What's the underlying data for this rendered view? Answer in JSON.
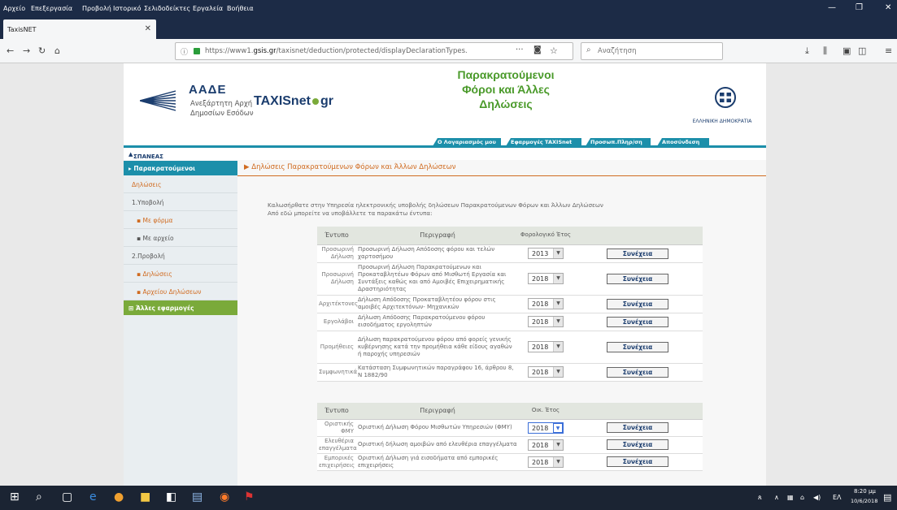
{
  "browser": {
    "menu": [
      "Αρχείο",
      "Επεξεργασία",
      "Προβολή",
      "Ιστορικό",
      "Σελιδοδείκτες",
      "Εργαλεία",
      "Βοήθεια"
    ],
    "tab_title": "TaxisNET",
    "url_prefix": "https://www1.",
    "url_domain": "gsis.gr",
    "url_rest": "/taxisnet/deduction/protected/displayDeclarationTypes.",
    "search_placeholder": "Αναζήτηση"
  },
  "header": {
    "aade_logo": "ΑΑΔΕ",
    "aade_line1": "Ανεξάρτητη Αρχή",
    "aade_line2": "Δημοσίων Εσόδων",
    "taxis_logo_a": "TAXISnet",
    "taxis_logo_b": "gr",
    "site_title_1": "Παρακρατούμενοι",
    "site_title_2": "Φόροι και Άλλες",
    "site_title_3": "Δηλώσεις",
    "hd_label": "ΕΛΛΗΝΙΚΗ ΔΗΜΟΚΡΑΤΙΑ"
  },
  "topnav": [
    "Ο Λογαριασμός μου",
    "Εφαρμογές TAXISnet",
    "Προσωπ.Πληρ/ση",
    "Αποσύνδεση"
  ],
  "user": "ΣΠΑΝΕΑΣ ΛΕΩ. ΔΗΜΗΤΡΙΟΣ",
  "sidebar": {
    "section": "Παρακρατούμενοι",
    "items": [
      "Δηλώσεις",
      "1.Υποβολή",
      "Με φόρμα",
      "Με αρχείο",
      "2.Προβολή",
      "Δηλώσεις",
      "Αρχείου Δηλώσεων"
    ],
    "other": "Άλλες εφαρμογές"
  },
  "content": {
    "title": "Δηλώσεις Παρακρατούμενων Φόρων και Άλλων Δηλώσεων",
    "intro_1": "Καλωσήρθατε στην Υπηρεσία ηλεκτρονικής υποβολής δηλώσεων Παρακρατούμενων Φόρων και Άλλων Δηλώσεων",
    "intro_2": "Από εδώ μπορείτε να υποβάλλετε τα παρακάτω έντυπα:",
    "table1_headers": [
      "Έντυπο",
      "Περιγραφή",
      "Φορολογικό Έτος"
    ],
    "table2_headers": [
      "Έντυπο",
      "Περιγραφή",
      "Οικ. Έτος"
    ],
    "button_label": "Συνέχεια",
    "table1_rows": [
      {
        "form": "Προσωρινή Δήλωση",
        "desc": "Προσωρινή Δήλωση Απόδοσης φόρου και τελών χαρτοσήμου",
        "year": "2013"
      },
      {
        "form": "Προσωρινή Δήλωση",
        "desc": "Προσωρινή Δήλωση Παρακρατούμενων και Προκαταβλητέων Φόρων από Μισθωτή Εργασία και Συντάξεις καθώς και από Αμοιβές Επιχειρηματικής Δραστηριότητας",
        "year": "2018"
      },
      {
        "form": "Αρχιτέκτονες",
        "desc": "Δήλωση Απόδοσης Προκαταβλητέου φόρου στις αμοιβές Αρχιτεκτόνων- Μηχανικών",
        "year": "2018"
      },
      {
        "form": "Εργολάβοι",
        "desc": "Δήλωση Απόδοσης Παρακρατούμενου φόρου εισοδήματος εργοληπτών",
        "year": "2018"
      },
      {
        "form": "Προμήθειες",
        "desc": "Δήλωση παρακρατούμενου φόρου από φορείς γενικής κυβέρνησης κατά την προμήθεια κάθε είδους αγαθών ή παροχής υπηρεσιών",
        "year": "2018"
      },
      {
        "form": "Συμφωνητικά",
        "desc": "Κατάσταση Συμφωνητικών παραγράφου 16, άρθρου 8, Ν 1882/90",
        "year": "2018"
      }
    ],
    "table2_rows": [
      {
        "form": "Οριστικής ΦΜΥ",
        "desc": "Οριστική Δήλωση Φόρου Μισθωτών Υπηρεσιών (ΦΜΥ)",
        "year": "2018"
      },
      {
        "form": "Ελευθέρια επαγγέλματα",
        "desc": "Οριστική δήλωση αμοιβών από ελευθέρια επαγγέλματα",
        "year": "2018"
      },
      {
        "form": "Εμπορικές επιχειρήσεις",
        "desc": "Οριστική Δήλωση γιά εισοδήματα από εμπορικές επιχειρήσεις",
        "year": "2018"
      }
    ]
  },
  "taskbar": {
    "lang": "ΕΛ",
    "time": "8:20 μμ",
    "date": "10/6/2018"
  },
  "icons": [
    "back-icon",
    "forward-icon",
    "reload-icon",
    "home-icon",
    "lock-icon",
    "bookmark-star-icon",
    "search-icon",
    "download-icon",
    "library-icon",
    "minimize-icon",
    "maximize-icon",
    "close-icon"
  ],
  "colors": {
    "teal": "#1c8faa",
    "green": "#7aaa3a",
    "orange": "#d06b20",
    "navy": "#1b3d6e"
  }
}
